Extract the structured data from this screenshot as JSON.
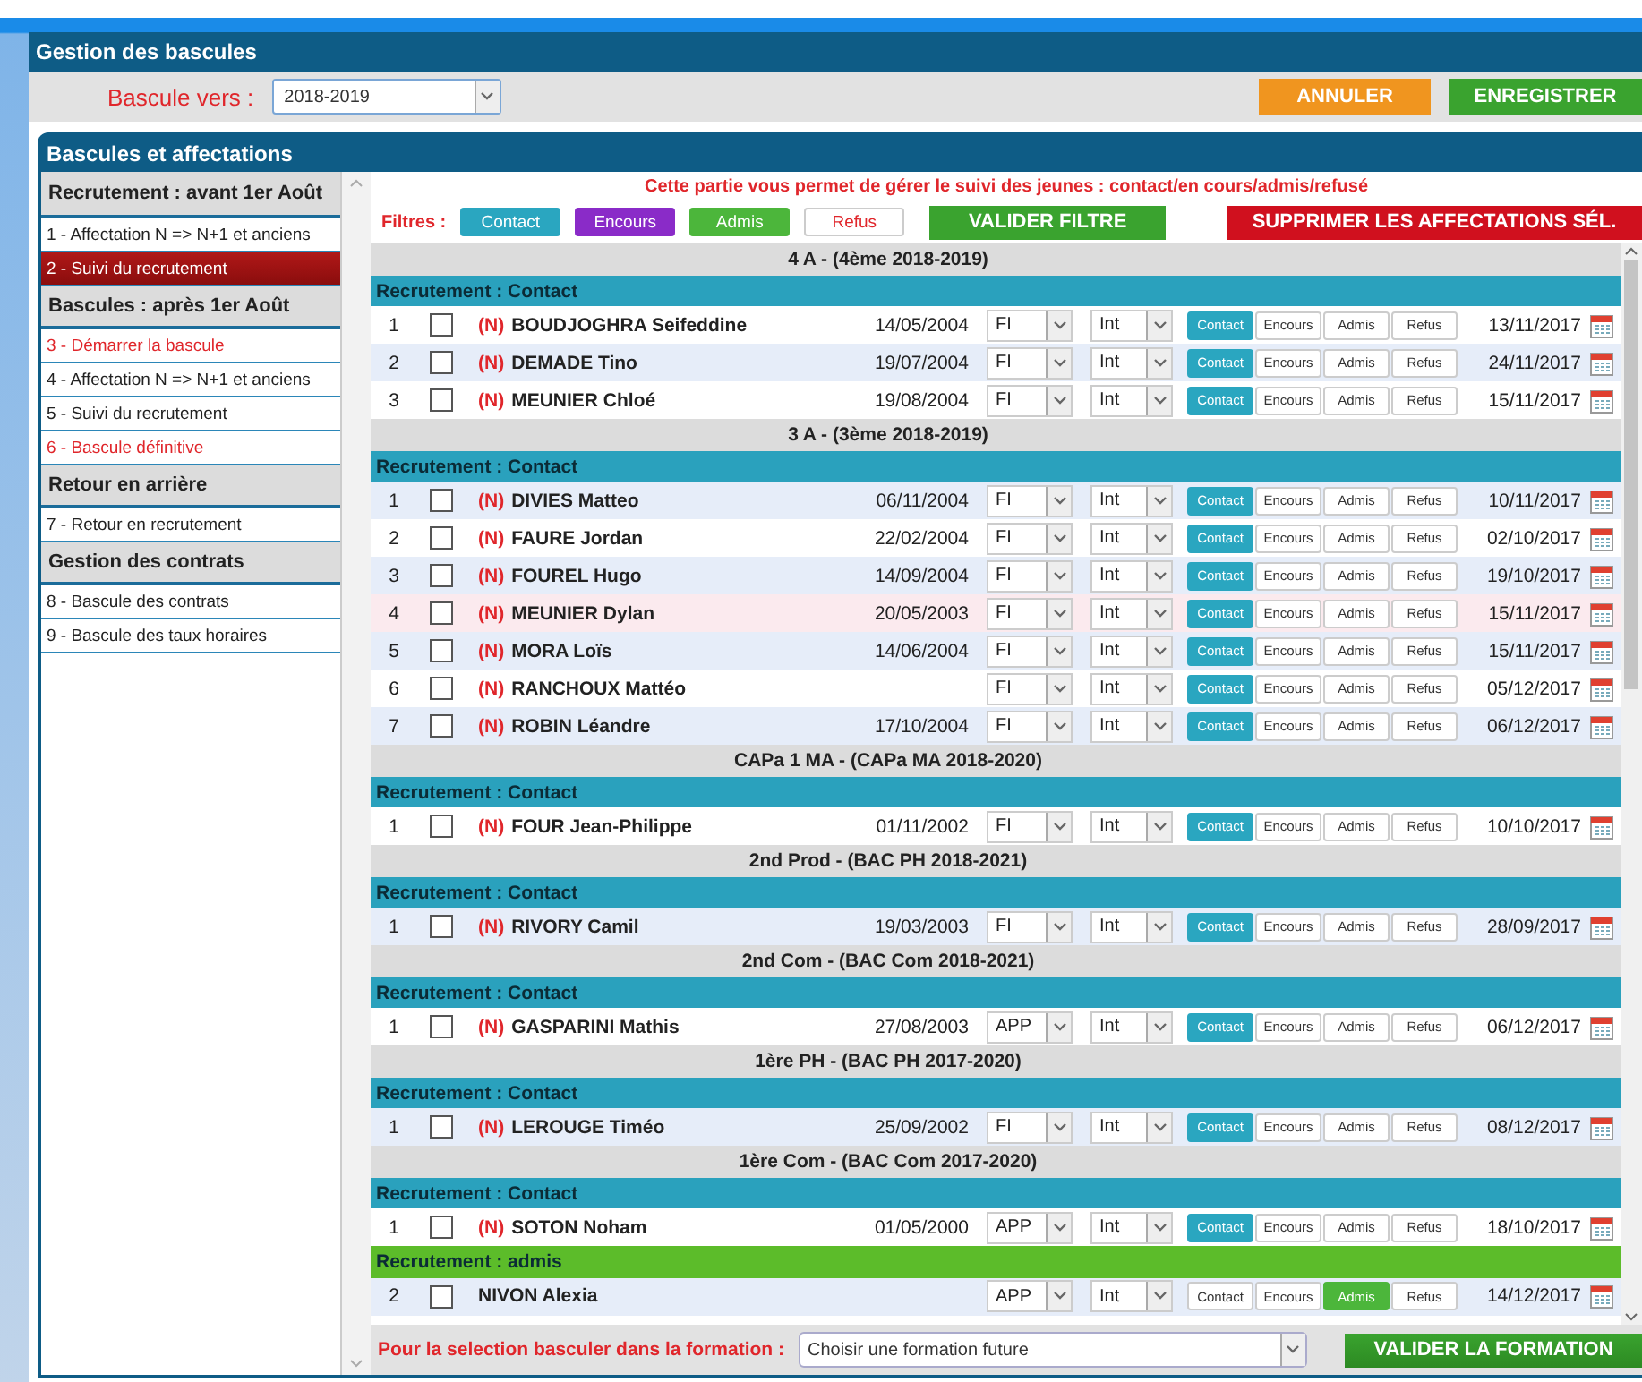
{
  "header": {
    "title": "Gestion des bascules"
  },
  "toolbar": {
    "label": "Bascule vers :",
    "year": "2018-2019",
    "buttons": [
      {
        "label": "ANNULER",
        "kind": "cancel"
      },
      {
        "label": "ENREGISTRER",
        "kind": "save"
      }
    ]
  },
  "panel": {
    "title": "Bascules et affectations"
  },
  "sidebar": [
    {
      "title": "Recrutement : avant 1er Août",
      "items": [
        {
          "label": "1 - Affectation N => N+1 et anciens",
          "selected": false,
          "warning": false
        },
        {
          "label": "2 - Suivi du recrutement",
          "selected": true,
          "warning": false
        }
      ]
    },
    {
      "title": "Bascules : après 1er Août",
      "items": [
        {
          "label": "3 - Démarrer la bascule",
          "selected": false,
          "warning": true
        },
        {
          "label": "4 - Affectation N => N+1 et anciens",
          "selected": false,
          "warning": false
        },
        {
          "label": "5 - Suivi du recrutement",
          "selected": false,
          "warning": false
        },
        {
          "label": "6 - Bascule définitive",
          "selected": false,
          "warning": true
        }
      ]
    },
    {
      "title": "Retour en arrière",
      "items": [
        {
          "label": "7 - Retour en recrutement",
          "selected": false,
          "warning": false
        }
      ]
    },
    {
      "title": "Gestion des contrats",
      "items": [
        {
          "label": "8 - Bascule des contrats",
          "selected": false,
          "warning": false
        },
        {
          "label": "9 - Bascule des taux horaires",
          "selected": false,
          "warning": false
        }
      ]
    }
  ],
  "info": "Cette partie vous permet de gérer le suivi des jeunes : contact/en cours/admis/refusé",
  "filters": {
    "label": "Filtres :",
    "options": [
      "Contact",
      "Encours",
      "Admis",
      "Refus"
    ],
    "apply": "VALIDER FILTRE",
    "delete": "SUPPRIMER LES AFFECTATIONS SÉL."
  },
  "groups": [
    {
      "title": "4 A - (4ème 2018-2019)",
      "sections": [
        {
          "status": "Recrutement : Contact",
          "kind": "contact",
          "rows": [
            {
              "num": "1",
              "checked": false,
              "tag": "(N)",
              "name": "BOUDJOGHRA Seifeddine",
              "birth": "14/05/2004",
              "type": "FI",
              "mode": "Int",
              "statuses": [
                {
                  "label": "Contact",
                  "selected": true
                },
                {
                  "label": "Encours",
                  "selected": false
                },
                {
                  "label": "Admis",
                  "selected": false
                },
                {
                  "label": "Refus",
                  "selected": false
                }
              ],
              "date": "13/11/2017",
              "hovered": false
            },
            {
              "num": "2",
              "checked": false,
              "tag": "(N)",
              "name": "DEMADE Tino",
              "birth": "19/07/2004",
              "type": "FI",
              "mode": "Int",
              "statuses": [
                {
                  "label": "Contact",
                  "selected": true
                },
                {
                  "label": "Encours",
                  "selected": false
                },
                {
                  "label": "Admis",
                  "selected": false
                },
                {
                  "label": "Refus",
                  "selected": false
                }
              ],
              "date": "24/11/2017",
              "hovered": false
            },
            {
              "num": "3",
              "checked": false,
              "tag": "(N)",
              "name": "MEUNIER Chloé",
              "birth": "19/08/2004",
              "type": "FI",
              "mode": "Int",
              "statuses": [
                {
                  "label": "Contact",
                  "selected": true
                },
                {
                  "label": "Encours",
                  "selected": false
                },
                {
                  "label": "Admis",
                  "selected": false
                },
                {
                  "label": "Refus",
                  "selected": false
                }
              ],
              "date": "15/11/2017",
              "hovered": false
            }
          ]
        }
      ]
    },
    {
      "title": "3 A - (3ème 2018-2019)",
      "sections": [
        {
          "status": "Recrutement : Contact",
          "kind": "contact",
          "rows": [
            {
              "num": "1",
              "checked": false,
              "tag": "(N)",
              "name": "DIVIES Matteo",
              "birth": "06/11/2004",
              "type": "FI",
              "mode": "Int",
              "statuses": [
                {
                  "label": "Contact",
                  "selected": true
                },
                {
                  "label": "Encours",
                  "selected": false
                },
                {
                  "label": "Admis",
                  "selected": false
                },
                {
                  "label": "Refus",
                  "selected": false
                }
              ],
              "date": "10/11/2017",
              "hovered": false
            },
            {
              "num": "2",
              "checked": false,
              "tag": "(N)",
              "name": "FAURE Jordan",
              "birth": "22/02/2004",
              "type": "FI",
              "mode": "Int",
              "statuses": [
                {
                  "label": "Contact",
                  "selected": true
                },
                {
                  "label": "Encours",
                  "selected": false
                },
                {
                  "label": "Admis",
                  "selected": false
                },
                {
                  "label": "Refus",
                  "selected": false
                }
              ],
              "date": "02/10/2017",
              "hovered": false
            },
            {
              "num": "3",
              "checked": false,
              "tag": "(N)",
              "name": "FOUREL Hugo",
              "birth": "14/09/2004",
              "type": "FI",
              "mode": "Int",
              "statuses": [
                {
                  "label": "Contact",
                  "selected": true
                },
                {
                  "label": "Encours",
                  "selected": false
                },
                {
                  "label": "Admis",
                  "selected": false
                },
                {
                  "label": "Refus",
                  "selected": false
                }
              ],
              "date": "19/10/2017",
              "hovered": false
            },
            {
              "num": "4",
              "checked": false,
              "tag": "(N)",
              "name": "MEUNIER Dylan",
              "birth": "20/05/2003",
              "type": "FI",
              "mode": "Int",
              "statuses": [
                {
                  "label": "Contact",
                  "selected": true
                },
                {
                  "label": "Encours",
                  "selected": false
                },
                {
                  "label": "Admis",
                  "selected": false
                },
                {
                  "label": "Refus",
                  "selected": false
                }
              ],
              "date": "15/11/2017",
              "hovered": true
            },
            {
              "num": "5",
              "checked": false,
              "tag": "(N)",
              "name": "MORA Loïs",
              "birth": "14/06/2004",
              "type": "FI",
              "mode": "Int",
              "statuses": [
                {
                  "label": "Contact",
                  "selected": true
                },
                {
                  "label": "Encours",
                  "selected": false
                },
                {
                  "label": "Admis",
                  "selected": false
                },
                {
                  "label": "Refus",
                  "selected": false
                }
              ],
              "date": "15/11/2017",
              "hovered": false
            },
            {
              "num": "6",
              "checked": false,
              "tag": "(N)",
              "name": "RANCHOUX Mattéo",
              "type": "FI",
              "mode": "Int",
              "statuses": [
                {
                  "label": "Contact",
                  "selected": true
                },
                {
                  "label": "Encours",
                  "selected": false
                },
                {
                  "label": "Admis",
                  "selected": false
                },
                {
                  "label": "Refus",
                  "selected": false
                }
              ],
              "date": "05/12/2017",
              "hovered": false
            },
            {
              "num": "7",
              "checked": false,
              "tag": "(N)",
              "name": "ROBIN Léandre",
              "birth": "17/10/2004",
              "type": "FI",
              "mode": "Int",
              "statuses": [
                {
                  "label": "Contact",
                  "selected": true
                },
                {
                  "label": "Encours",
                  "selected": false
                },
                {
                  "label": "Admis",
                  "selected": false
                },
                {
                  "label": "Refus",
                  "selected": false
                }
              ],
              "date": "06/12/2017",
              "hovered": false
            }
          ]
        }
      ]
    },
    {
      "title": "CAPa 1 MA - (CAPa MA 2018-2020)",
      "sections": [
        {
          "status": "Recrutement : Contact",
          "kind": "contact",
          "rows": [
            {
              "num": "1",
              "checked": false,
              "tag": "(N)",
              "name": "FOUR Jean-Philippe",
              "birth": "01/11/2002",
              "type": "FI",
              "mode": "Int",
              "statuses": [
                {
                  "label": "Contact",
                  "selected": true
                },
                {
                  "label": "Encours",
                  "selected": false
                },
                {
                  "label": "Admis",
                  "selected": false
                },
                {
                  "label": "Refus",
                  "selected": false
                }
              ],
              "date": "10/10/2017",
              "hovered": false
            }
          ]
        }
      ]
    },
    {
      "title": "2nd Prod - (BAC PH 2018-2021)",
      "sections": [
        {
          "status": "Recrutement : Contact",
          "kind": "contact",
          "rows": [
            {
              "num": "1",
              "checked": false,
              "tag": "(N)",
              "name": "RIVORY Camil",
              "birth": "19/03/2003",
              "type": "FI",
              "mode": "Int",
              "statuses": [
                {
                  "label": "Contact",
                  "selected": true
                },
                {
                  "label": "Encours",
                  "selected": false
                },
                {
                  "label": "Admis",
                  "selected": false
                },
                {
                  "label": "Refus",
                  "selected": false
                }
              ],
              "date": "28/09/2017",
              "hovered": false
            }
          ]
        }
      ]
    },
    {
      "title": "2nd Com - (BAC Com 2018-2021)",
      "sections": [
        {
          "status": "Recrutement : Contact",
          "kind": "contact",
          "rows": [
            {
              "num": "1",
              "checked": false,
              "tag": "(N)",
              "name": "GASPARINI Mathis",
              "birth": "27/08/2003",
              "type": "APP",
              "mode": "Int",
              "statuses": [
                {
                  "label": "Contact",
                  "selected": true
                },
                {
                  "label": "Encours",
                  "selected": false
                },
                {
                  "label": "Admis",
                  "selected": false
                },
                {
                  "label": "Refus",
                  "selected": false
                }
              ],
              "date": "06/12/2017",
              "hovered": false
            }
          ]
        }
      ]
    },
    {
      "title": "1ère PH - (BAC PH 2017-2020)",
      "sections": [
        {
          "status": "Recrutement : Contact",
          "kind": "contact",
          "rows": [
            {
              "num": "1",
              "checked": false,
              "tag": "(N)",
              "name": "LEROUGE Timéo",
              "birth": "25/09/2002",
              "type": "FI",
              "mode": "Int",
              "statuses": [
                {
                  "label": "Contact",
                  "selected": true
                },
                {
                  "label": "Encours",
                  "selected": false
                },
                {
                  "label": "Admis",
                  "selected": false
                },
                {
                  "label": "Refus",
                  "selected": false
                }
              ],
              "date": "08/12/2017",
              "hovered": false
            }
          ]
        }
      ]
    },
    {
      "title": "1ère Com - (BAC Com 2017-2020)",
      "sections": [
        {
          "status": "Recrutement : Contact",
          "kind": "contact",
          "rows": [
            {
              "num": "1",
              "checked": false,
              "tag": "(N)",
              "name": "SOTON Noham",
              "birth": "01/05/2000",
              "type": "APP",
              "mode": "Int",
              "statuses": [
                {
                  "label": "Contact",
                  "selected": true
                },
                {
                  "label": "Encours",
                  "selected": false
                },
                {
                  "label": "Admis",
                  "selected": false
                },
                {
                  "label": "Refus",
                  "selected": false
                }
              ],
              "date": "18/10/2017",
              "hovered": false
            }
          ]
        },
        {
          "status": "Recrutement : admis",
          "kind": "admis",
          "rows": [
            {
              "num": "2",
              "checked": false,
              "name": "NIVON Alexia",
              "type": "APP",
              "mode": "Int",
              "statuses": [
                {
                  "label": "Contact",
                  "selected": false
                },
                {
                  "label": "Encours",
                  "selected": false
                },
                {
                  "label": "Admis",
                  "selected": true
                },
                {
                  "label": "Refus",
                  "selected": false
                }
              ],
              "date": "14/12/2017",
              "hovered": false
            }
          ]
        }
      ]
    }
  ],
  "footer": {
    "label": "Pour la selection basculer dans la formation :",
    "placeholder": "Choisir une formation future",
    "button": "VALIDER LA FORMATION"
  }
}
